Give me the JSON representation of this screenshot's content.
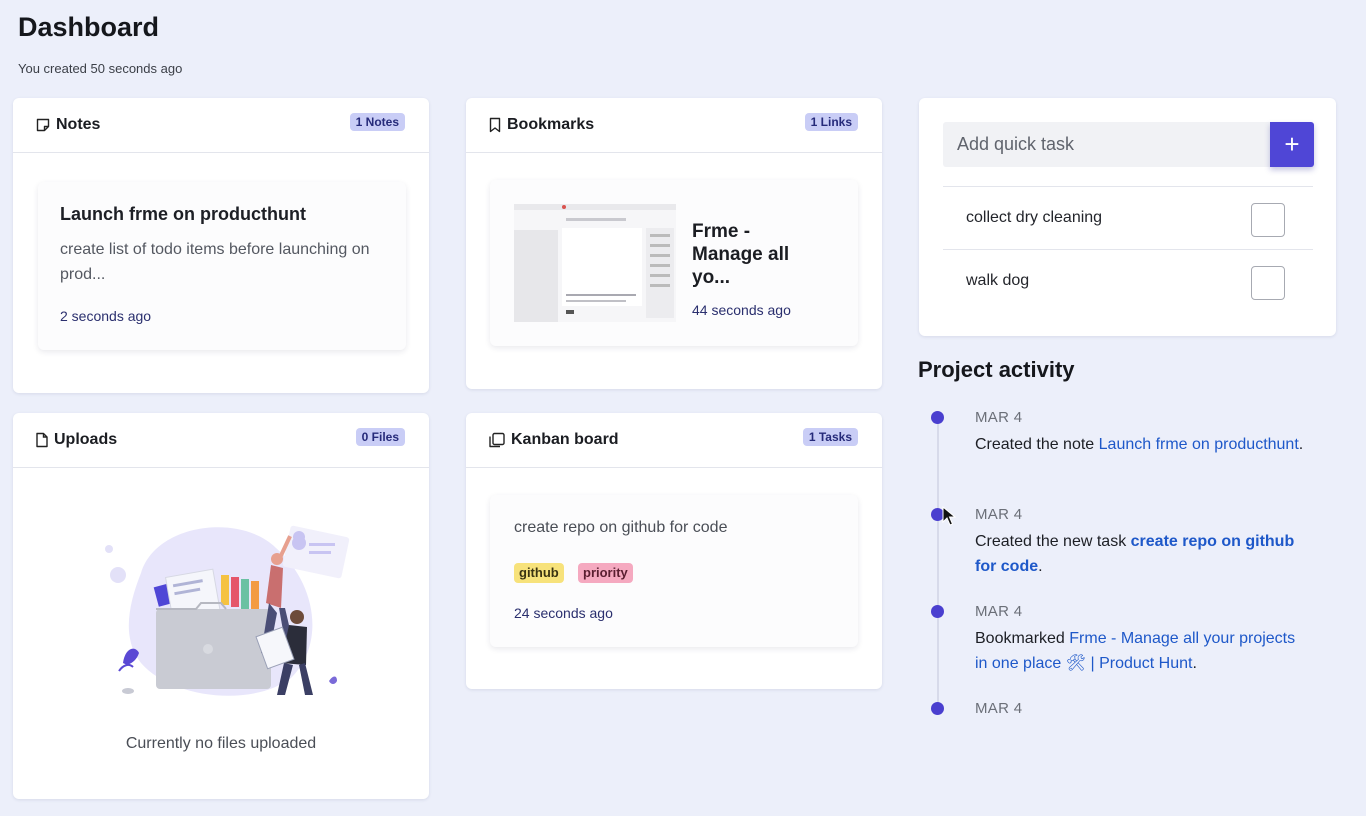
{
  "header": {
    "title": "Dashboard",
    "subtitle": "You created 50 seconds ago"
  },
  "notes": {
    "title": "Notes",
    "badge": "1 Notes",
    "item": {
      "title": "Launch frme on producthunt",
      "body": "create list of todo items before launching on prod...",
      "time": "2 seconds ago"
    }
  },
  "bookmarks": {
    "title": "Bookmarks",
    "badge": "1 Links",
    "item": {
      "title": "Frme - Manage all yo...",
      "time": "44 seconds ago"
    }
  },
  "uploads": {
    "title": "Uploads",
    "badge": "0 Files",
    "empty_text": "Currently no files uploaded"
  },
  "kanban": {
    "title": "Kanban board",
    "badge": "1 Tasks",
    "item": {
      "text": "create repo on github for code",
      "tags": [
        "github",
        "priority"
      ],
      "time": "24 seconds ago"
    }
  },
  "tasks": {
    "placeholder": "Add quick task",
    "add_label": "+",
    "items": [
      {
        "label": "collect dry cleaning",
        "done": false
      },
      {
        "label": "walk dog",
        "done": false
      }
    ]
  },
  "activity": {
    "title": "Project activity",
    "entries": [
      {
        "date": "MAR 4",
        "prefix": "Created the note ",
        "link": "Launch frme on producthunt",
        "suffix": "."
      },
      {
        "date": "MAR 4",
        "prefix": "Created the new task ",
        "link": "create repo on github for code",
        "suffix": "."
      },
      {
        "date": "MAR 4",
        "prefix": "Bookmarked ",
        "link": "Frme - Manage all your projects in one place 🛠  | Product Hunt",
        "suffix": "."
      },
      {
        "date": "MAR 4"
      }
    ]
  },
  "colors": {
    "accent": "#4f46d6",
    "badge_bg": "#c9cdf6",
    "link": "#1e58c9",
    "page_bg": "#eceffa"
  }
}
